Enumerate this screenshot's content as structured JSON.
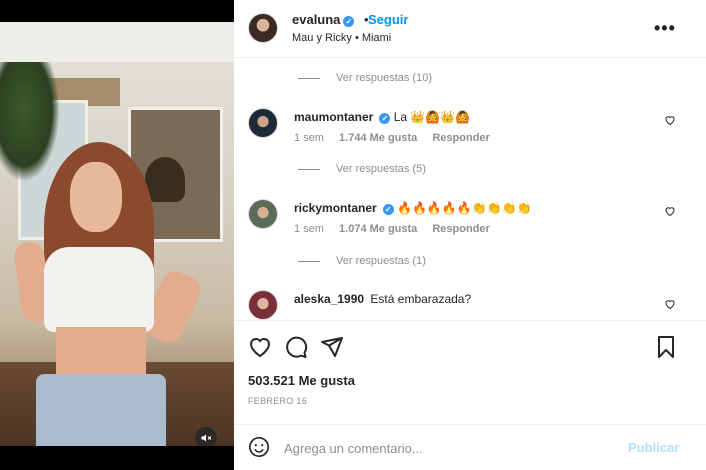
{
  "post": {
    "username": "evaluna",
    "follow_label": "Seguir",
    "separator": "•",
    "subtitle": "Mau y Ricky • Miami",
    "more_icon": "more-horizontal-icon"
  },
  "comments_section": {
    "replies_top": "Ver respuestas (10)",
    "comments": [
      {
        "username": "maumontaner",
        "text": "La 👑🙆👑🙆",
        "time": "1 sem",
        "likes": "1.744 Me gusta",
        "reply": "Responder",
        "replies": "Ver respuestas (5)"
      },
      {
        "username": "rickymontaner",
        "text": "🔥🔥🔥🔥🔥👏👏👏👏",
        "time": "1 sem",
        "likes": "1.074 Me gusta",
        "reply": "Responder",
        "replies": "Ver respuestas (1)"
      },
      {
        "username": "aleska_1990",
        "text": "Está embarazada?"
      }
    ]
  },
  "actions": {
    "likes": "503.521 Me gusta",
    "date": "FEBRERO 16"
  },
  "add_comment": {
    "placeholder": "Agrega un comentario...",
    "publish_label": "Publicar"
  },
  "colors": {
    "accent": "#0095f6",
    "verified": "#3897f0",
    "muted_text": "#8e8e8e",
    "publish_disabled": "#b2dffc"
  }
}
